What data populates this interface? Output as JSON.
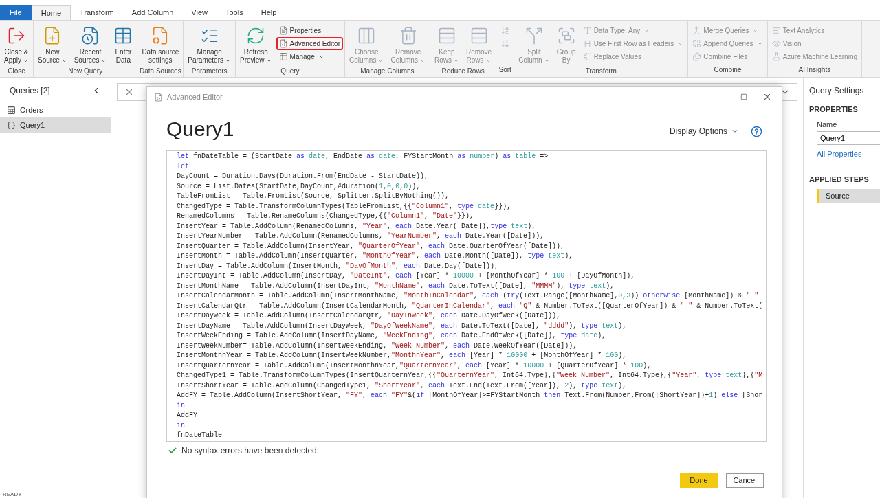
{
  "menu_tabs": [
    {
      "label": "File",
      "kind": "file",
      "selected": false
    },
    {
      "label": "Home",
      "kind": "tab",
      "selected": true
    },
    {
      "label": "Transform",
      "kind": "tab",
      "selected": false
    },
    {
      "label": "Add Column",
      "kind": "tab",
      "selected": false
    },
    {
      "label": "View",
      "kind": "tab",
      "selected": false
    },
    {
      "label": "Tools",
      "kind": "tab",
      "selected": false
    },
    {
      "label": "Help",
      "kind": "tab",
      "selected": false
    }
  ],
  "ribbon": [
    {
      "label": "Close",
      "items": [
        {
          "kind": "large",
          "lines": [
            "Close &",
            "Apply"
          ],
          "dropdown": true,
          "disabled": false,
          "highlighted": false
        }
      ]
    },
    {
      "label": "New Query",
      "items": [
        {
          "kind": "large",
          "lines": [
            "New",
            "Source"
          ],
          "dropdown": true,
          "disabled": false,
          "highlighted": false
        },
        {
          "kind": "large",
          "lines": [
            "Recent",
            "Sources"
          ],
          "dropdown": true,
          "disabled": false,
          "highlighted": false
        },
        {
          "kind": "large",
          "lines": [
            "Enter",
            "Data"
          ],
          "dropdown": false,
          "disabled": false,
          "highlighted": false
        }
      ]
    },
    {
      "label": "Data Sources",
      "items": [
        {
          "kind": "large",
          "lines": [
            "Data source",
            "settings"
          ],
          "dropdown": false,
          "disabled": false,
          "highlighted": false
        }
      ]
    },
    {
      "label": "Parameters",
      "items": [
        {
          "kind": "large",
          "lines": [
            "Manage",
            "Parameters"
          ],
          "dropdown": true,
          "disabled": false,
          "highlighted": false
        }
      ]
    },
    {
      "label": "Query",
      "items": [
        {
          "kind": "large",
          "lines": [
            "Refresh",
            "Preview"
          ],
          "dropdown": true,
          "disabled": false,
          "highlighted": false
        },
        {
          "kind": "small",
          "lines": [
            "Properties"
          ],
          "dropdown": false,
          "disabled": false,
          "highlighted": false
        },
        {
          "kind": "small",
          "lines": [
            "Advanced Editor"
          ],
          "dropdown": false,
          "disabled": false,
          "highlighted": true
        },
        {
          "kind": "small",
          "lines": [
            "Manage"
          ],
          "dropdown": true,
          "disabled": false,
          "highlighted": false
        }
      ]
    },
    {
      "label": "Manage Columns",
      "items": [
        {
          "kind": "large",
          "lines": [
            "Choose",
            "Columns"
          ],
          "dropdown": true,
          "disabled": true,
          "highlighted": false
        },
        {
          "kind": "large",
          "lines": [
            "Remove",
            "Columns"
          ],
          "dropdown": true,
          "disabled": true,
          "highlighted": false
        }
      ]
    },
    {
      "label": "Reduce Rows",
      "items": [
        {
          "kind": "large",
          "lines": [
            "Keep",
            "Rows"
          ],
          "dropdown": true,
          "disabled": true,
          "highlighted": false
        },
        {
          "kind": "large",
          "lines": [
            "Remove",
            "Rows"
          ],
          "dropdown": true,
          "disabled": true,
          "highlighted": false
        }
      ]
    },
    {
      "label": "Sort",
      "items": [
        {
          "kind": "icon",
          "dropdown": false,
          "disabled": true,
          "highlighted": false
        },
        {
          "kind": "icon",
          "dropdown": false,
          "disabled": true,
          "highlighted": false
        }
      ]
    },
    {
      "label": "Transform",
      "items": [
        {
          "kind": "large",
          "lines": [
            "Split",
            "Column"
          ],
          "dropdown": true,
          "disabled": true,
          "highlighted": false
        },
        {
          "kind": "large",
          "lines": [
            "Group",
            "By"
          ],
          "dropdown": false,
          "disabled": true,
          "highlighted": false
        },
        {
          "kind": "small",
          "lines": [
            "Data Type: Any"
          ],
          "dropdown": true,
          "disabled": true,
          "highlighted": false
        },
        {
          "kind": "small",
          "lines": [
            "Use First Row as Headers"
          ],
          "dropdown": true,
          "disabled": true,
          "highlighted": false
        },
        {
          "kind": "small",
          "lines": [
            "Replace Values"
          ],
          "dropdown": false,
          "disabled": true,
          "highlighted": false
        }
      ]
    },
    {
      "label": "Combine",
      "items": [
        {
          "kind": "small",
          "lines": [
            "Merge Queries"
          ],
          "dropdown": true,
          "disabled": true,
          "highlighted": false
        },
        {
          "kind": "small",
          "lines": [
            "Append Queries"
          ],
          "dropdown": true,
          "disabled": true,
          "highlighted": false
        },
        {
          "kind": "small",
          "lines": [
            "Combine Files"
          ],
          "dropdown": false,
          "disabled": true,
          "highlighted": false
        }
      ]
    },
    {
      "label": "AI Insights",
      "items": [
        {
          "kind": "small",
          "lines": [
            "Text Analytics"
          ],
          "dropdown": false,
          "disabled": true,
          "highlighted": false
        },
        {
          "kind": "small",
          "lines": [
            "Vision"
          ],
          "dropdown": false,
          "disabled": true,
          "highlighted": false
        },
        {
          "kind": "small",
          "lines": [
            "Azure Machine Learning"
          ],
          "dropdown": false,
          "disabled": true,
          "highlighted": false
        }
      ]
    }
  ],
  "queries_pane": {
    "title": "Queries [2]",
    "items": [
      {
        "label": "Orders",
        "kind": "table",
        "selected": false
      },
      {
        "label": "Query1",
        "kind": "function",
        "selected": true
      }
    ]
  },
  "query_settings": {
    "title": "Query Settings",
    "properties_heading": "PROPERTIES",
    "name_label": "Name",
    "name_value": "Query1",
    "all_properties_link": "All Properties",
    "steps_heading": "APPLIED STEPS",
    "steps": [
      {
        "label": "Source",
        "selected": true
      }
    ]
  },
  "status_bar": "READY",
  "dialog": {
    "title": "Advanced Editor",
    "query_name": "Query1",
    "display_options": "Display Options",
    "status": "No syntax errors have been detected.",
    "buttons": [
      {
        "label": "Done",
        "kind": "primary"
      },
      {
        "label": "Cancel",
        "kind": "secondary"
      }
    ],
    "code": [
      [
        {
          "kind": "kw",
          "text": "let"
        },
        {
          "kind": "p",
          "text": " fnDateTable = (StartDate "
        },
        {
          "kind": "kw",
          "text": "as"
        },
        {
          "kind": "lit",
          "text": " date"
        },
        {
          "kind": "p",
          "text": ", EndDate "
        },
        {
          "kind": "kw",
          "text": "as"
        },
        {
          "kind": "lit",
          "text": " date"
        },
        {
          "kind": "p",
          "text": ", FYStartMonth "
        },
        {
          "kind": "kw",
          "text": "as"
        },
        {
          "kind": "lit",
          "text": " number"
        },
        {
          "kind": "p",
          "text": ") "
        },
        {
          "kind": "kw",
          "text": "as"
        },
        {
          "kind": "lit",
          "text": " table"
        },
        {
          "kind": "p",
          "text": " =>"
        }
      ],
      [
        {
          "kind": "kw",
          "text": "let"
        }
      ],
      [
        {
          "kind": "p",
          "text": "DayCount = Duration.Days(Duration.From(EndDate - StartDate)),"
        }
      ],
      [
        {
          "kind": "p",
          "text": "Source = List.Dates(StartDate,DayCount,#duration("
        },
        {
          "kind": "lit",
          "text": "1"
        },
        {
          "kind": "p",
          "text": ","
        },
        {
          "kind": "lit",
          "text": "0"
        },
        {
          "kind": "p",
          "text": ","
        },
        {
          "kind": "lit",
          "text": "0"
        },
        {
          "kind": "p",
          "text": ","
        },
        {
          "kind": "lit",
          "text": "0"
        },
        {
          "kind": "p",
          "text": ")),"
        }
      ],
      [
        {
          "kind": "p",
          "text": "TableFromList = Table.FromList(Source, Splitter.SplitByNothing()),"
        }
      ],
      [
        {
          "kind": "p",
          "text": "ChangedType = Table.TransformColumnTypes(TableFromList,{{"
        },
        {
          "kind": "str",
          "text": "\"Column1\""
        },
        {
          "kind": "p",
          "text": ", "
        },
        {
          "kind": "kw",
          "text": "type"
        },
        {
          "kind": "lit",
          "text": " date"
        },
        {
          "kind": "p",
          "text": "}}),"
        }
      ],
      [
        {
          "kind": "p",
          "text": "RenamedColumns = Table.RenameColumns(ChangedType,{{"
        },
        {
          "kind": "str",
          "text": "\"Column1\""
        },
        {
          "kind": "p",
          "text": ", "
        },
        {
          "kind": "str",
          "text": "\"Date\""
        },
        {
          "kind": "p",
          "text": "}}),"
        }
      ],
      [
        {
          "kind": "p",
          "text": "InsertYear = Table.AddColumn(RenamedColumns, "
        },
        {
          "kind": "str",
          "text": "\"Year\""
        },
        {
          "kind": "p",
          "text": ", "
        },
        {
          "kind": "kw",
          "text": "each"
        },
        {
          "kind": "p",
          "text": " Date.Year([Date]),"
        },
        {
          "kind": "kw",
          "text": "type"
        },
        {
          "kind": "lit",
          "text": " text"
        },
        {
          "kind": "p",
          "text": "),"
        }
      ],
      [
        {
          "kind": "p",
          "text": "InsertYearNumber = Table.AddColumn(RenamedColumns, "
        },
        {
          "kind": "str",
          "text": "\"YearNumber\""
        },
        {
          "kind": "p",
          "text": ", "
        },
        {
          "kind": "kw",
          "text": "each"
        },
        {
          "kind": "p",
          "text": " Date.Year([Date])),"
        }
      ],
      [
        {
          "kind": "p",
          "text": "InsertQuarter = Table.AddColumn(InsertYear, "
        },
        {
          "kind": "str",
          "text": "\"QuarterOfYear\""
        },
        {
          "kind": "p",
          "text": ", "
        },
        {
          "kind": "kw",
          "text": "each"
        },
        {
          "kind": "p",
          "text": " Date.QuarterOfYear([Date])),"
        }
      ],
      [
        {
          "kind": "p",
          "text": "InsertMonth = Table.AddColumn(InsertQuarter, "
        },
        {
          "kind": "str",
          "text": "\"MonthOfYear\""
        },
        {
          "kind": "p",
          "text": ", "
        },
        {
          "kind": "kw",
          "text": "each"
        },
        {
          "kind": "p",
          "text": " Date.Month([Date]), "
        },
        {
          "kind": "kw",
          "text": "type"
        },
        {
          "kind": "lit",
          "text": " text"
        },
        {
          "kind": "p",
          "text": "),"
        }
      ],
      [
        {
          "kind": "p",
          "text": "InsertDay = Table.AddColumn(InsertMonth, "
        },
        {
          "kind": "str",
          "text": "\"DayOfMonth\""
        },
        {
          "kind": "p",
          "text": ", "
        },
        {
          "kind": "kw",
          "text": "each"
        },
        {
          "kind": "p",
          "text": " Date.Day([Date])),"
        }
      ],
      [
        {
          "kind": "p",
          "text": "InsertDayInt = Table.AddColumn(InsertDay, "
        },
        {
          "kind": "str",
          "text": "\"DateInt\""
        },
        {
          "kind": "p",
          "text": ", "
        },
        {
          "kind": "kw",
          "text": "each"
        },
        {
          "kind": "p",
          "text": " [Year] * "
        },
        {
          "kind": "lit",
          "text": "10000"
        },
        {
          "kind": "p",
          "text": " + [MonthOfYear] * "
        },
        {
          "kind": "lit",
          "text": "100"
        },
        {
          "kind": "p",
          "text": " + [DayOfMonth]),"
        }
      ],
      [
        {
          "kind": "p",
          "text": "InsertMonthName = Table.AddColumn(InsertDayInt, "
        },
        {
          "kind": "str",
          "text": "\"MonthName\""
        },
        {
          "kind": "p",
          "text": ", "
        },
        {
          "kind": "kw",
          "text": "each"
        },
        {
          "kind": "p",
          "text": " Date.ToText([Date], "
        },
        {
          "kind": "str",
          "text": "\"MMMM\""
        },
        {
          "kind": "p",
          "text": "), "
        },
        {
          "kind": "kw",
          "text": "type"
        },
        {
          "kind": "lit",
          "text": " text"
        },
        {
          "kind": "p",
          "text": "),"
        }
      ],
      [
        {
          "kind": "p",
          "text": "InsertCalendarMonth = Table.AddColumn(InsertMonthName, "
        },
        {
          "kind": "str",
          "text": "\"MonthInCalendar\""
        },
        {
          "kind": "p",
          "text": ", "
        },
        {
          "kind": "kw",
          "text": "each"
        },
        {
          "kind": "p",
          "text": " ("
        },
        {
          "kind": "kw",
          "text": "try"
        },
        {
          "kind": "p",
          "text": "(Text.Range([MonthName],"
        },
        {
          "kind": "lit",
          "text": "0"
        },
        {
          "kind": "p",
          "text": ","
        },
        {
          "kind": "lit",
          "text": "3"
        },
        {
          "kind": "p",
          "text": ")) "
        },
        {
          "kind": "kw",
          "text": "otherwise"
        },
        {
          "kind": "p",
          "text": " [MonthName]) & "
        },
        {
          "kind": "str",
          "text": "\" \""
        }
      ],
      [
        {
          "kind": "p",
          "text": "InsertCalendarQtr = Table.AddColumn(InsertCalendarMonth, "
        },
        {
          "kind": "str",
          "text": "\"QuarterInCalendar\""
        },
        {
          "kind": "p",
          "text": ", "
        },
        {
          "kind": "kw",
          "text": "each"
        },
        {
          "kind": "str",
          "text": " \"Q\""
        },
        {
          "kind": "p",
          "text": " & Number.ToText([QuarterOfYear]) & "
        },
        {
          "kind": "str",
          "text": "\" \""
        },
        {
          "kind": "p",
          "text": " & Number.ToText("
        }
      ],
      [
        {
          "kind": "p",
          "text": "InsertDayWeek = Table.AddColumn(InsertCalendarQtr, "
        },
        {
          "kind": "str",
          "text": "\"DayInWeek\""
        },
        {
          "kind": "p",
          "text": ", "
        },
        {
          "kind": "kw",
          "text": "each"
        },
        {
          "kind": "p",
          "text": " Date.DayOfWeek([Date])),"
        }
      ],
      [
        {
          "kind": "p",
          "text": "InsertDayName = Table.AddColumn(InsertDayWeek, "
        },
        {
          "kind": "str",
          "text": "\"DayOfWeekName\""
        },
        {
          "kind": "p",
          "text": ", "
        },
        {
          "kind": "kw",
          "text": "each"
        },
        {
          "kind": "p",
          "text": " Date.ToText([Date], "
        },
        {
          "kind": "str",
          "text": "\"dddd\""
        },
        {
          "kind": "p",
          "text": "), "
        },
        {
          "kind": "kw",
          "text": "type"
        },
        {
          "kind": "lit",
          "text": " text"
        },
        {
          "kind": "p",
          "text": "),"
        }
      ],
      [
        {
          "kind": "p",
          "text": "InsertWeekEnding = Table.AddColumn(InsertDayName, "
        },
        {
          "kind": "str",
          "text": "\"WeekEnding\""
        },
        {
          "kind": "p",
          "text": ", "
        },
        {
          "kind": "kw",
          "text": "each"
        },
        {
          "kind": "p",
          "text": " Date.EndOfWeek([Date]), "
        },
        {
          "kind": "kw",
          "text": "type"
        },
        {
          "kind": "lit",
          "text": " date"
        },
        {
          "kind": "p",
          "text": "),"
        }
      ],
      [
        {
          "kind": "p",
          "text": "InsertWeekNumber= Table.AddColumn(InsertWeekEnding, "
        },
        {
          "kind": "str",
          "text": "\"Week Number\""
        },
        {
          "kind": "p",
          "text": ", "
        },
        {
          "kind": "kw",
          "text": "each"
        },
        {
          "kind": "p",
          "text": " Date.WeekOfYear([Date])),"
        }
      ],
      [
        {
          "kind": "p",
          "text": "InsertMonthnYear = Table.AddColumn(InsertWeekNumber,"
        },
        {
          "kind": "str",
          "text": "\"MonthnYear\""
        },
        {
          "kind": "p",
          "text": ", "
        },
        {
          "kind": "kw",
          "text": "each"
        },
        {
          "kind": "p",
          "text": " [Year] * "
        },
        {
          "kind": "lit",
          "text": "10000"
        },
        {
          "kind": "p",
          "text": " + [MonthOfYear] * "
        },
        {
          "kind": "lit",
          "text": "100"
        },
        {
          "kind": "p",
          "text": "),"
        }
      ],
      [
        {
          "kind": "p",
          "text": "InsertQuarternYear = Table.AddColumn(InsertMonthnYear,"
        },
        {
          "kind": "str",
          "text": "\"QuarternYear\""
        },
        {
          "kind": "p",
          "text": ", "
        },
        {
          "kind": "kw",
          "text": "each"
        },
        {
          "kind": "p",
          "text": " [Year] * "
        },
        {
          "kind": "lit",
          "text": "10000"
        },
        {
          "kind": "p",
          "text": " + [QuarterOfYear] * "
        },
        {
          "kind": "lit",
          "text": "100"
        },
        {
          "kind": "p",
          "text": "),"
        }
      ],
      [
        {
          "kind": "p",
          "text": "ChangedType1 = Table.TransformColumnTypes(InsertQuarternYear,{{"
        },
        {
          "kind": "str",
          "text": "\"QuarternYear\""
        },
        {
          "kind": "p",
          "text": ", Int64.Type},{"
        },
        {
          "kind": "str",
          "text": "\"Week Number\""
        },
        {
          "kind": "p",
          "text": ", Int64.Type},{"
        },
        {
          "kind": "str",
          "text": "\"Year\""
        },
        {
          "kind": "p",
          "text": ", "
        },
        {
          "kind": "kw",
          "text": "type"
        },
        {
          "kind": "lit",
          "text": " text"
        },
        {
          "kind": "p",
          "text": "},{"
        },
        {
          "kind": "str",
          "text": "\"M"
        }
      ],
      [
        {
          "kind": "p",
          "text": "InsertShortYear = Table.AddColumn(ChangedType1, "
        },
        {
          "kind": "str",
          "text": "\"ShortYear\""
        },
        {
          "kind": "p",
          "text": ", "
        },
        {
          "kind": "kw",
          "text": "each"
        },
        {
          "kind": "p",
          "text": " Text.End(Text.From([Year]), "
        },
        {
          "kind": "lit",
          "text": "2"
        },
        {
          "kind": "p",
          "text": "), "
        },
        {
          "kind": "kw",
          "text": "type"
        },
        {
          "kind": "lit",
          "text": " text"
        },
        {
          "kind": "p",
          "text": "),"
        }
      ],
      [
        {
          "kind": "p",
          "text": "AddFY = Table.AddColumn(InsertShortYear, "
        },
        {
          "kind": "str",
          "text": "\"FY\""
        },
        {
          "kind": "p",
          "text": ", "
        },
        {
          "kind": "kw",
          "text": "each"
        },
        {
          "kind": "str",
          "text": " \"FY\""
        },
        {
          "kind": "p",
          "text": "&("
        },
        {
          "kind": "kw",
          "text": "if"
        },
        {
          "kind": "p",
          "text": " [MonthOfYear]>=FYStartMonth "
        },
        {
          "kind": "kw",
          "text": "then"
        },
        {
          "kind": "p",
          "text": " Text.From(Number.From([ShortYear])+"
        },
        {
          "kind": "lit",
          "text": "1"
        },
        {
          "kind": "p",
          "text": ") "
        },
        {
          "kind": "kw",
          "text": "else"
        },
        {
          "kind": "p",
          "text": " [Shor"
        }
      ],
      [
        {
          "kind": "kw",
          "text": "in"
        }
      ],
      [
        {
          "kind": "p",
          "text": "AddFY"
        }
      ],
      [
        {
          "kind": "kw",
          "text": "in"
        }
      ],
      [
        {
          "kind": "p",
          "text": "fnDateTable"
        }
      ]
    ]
  }
}
